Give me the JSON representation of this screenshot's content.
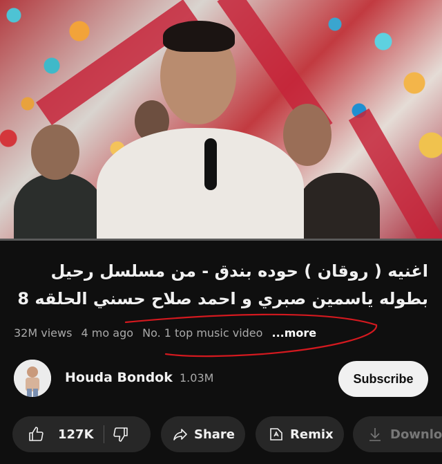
{
  "video": {
    "thumbnail": "music-video-frame-singer-with-microphone",
    "progress_fraction": 0.0
  },
  "title": "اغنيه ( روقان ) حوده بندق - من مسلسل رحيل بطوله ياسمين صبري و احمد صلاح حسني الحلقه 8",
  "meta": {
    "views": "32M views",
    "age": "4 mo ago",
    "badge": "No. 1 top music video",
    "more": "...more"
  },
  "annotation": {
    "color": "#d4191f"
  },
  "channel": {
    "name": "Houda Bondok",
    "subscribers": "1.03M",
    "subscribe_label": "Subscribe",
    "avatar": "avatar-person"
  },
  "actions": {
    "likes": "127K",
    "share_label": "Share",
    "remix_label": "Remix",
    "download_label": "Downloa"
  },
  "colors": {
    "background": "#0f0f0f",
    "progress": "#ff0000",
    "pill": "#272727"
  }
}
